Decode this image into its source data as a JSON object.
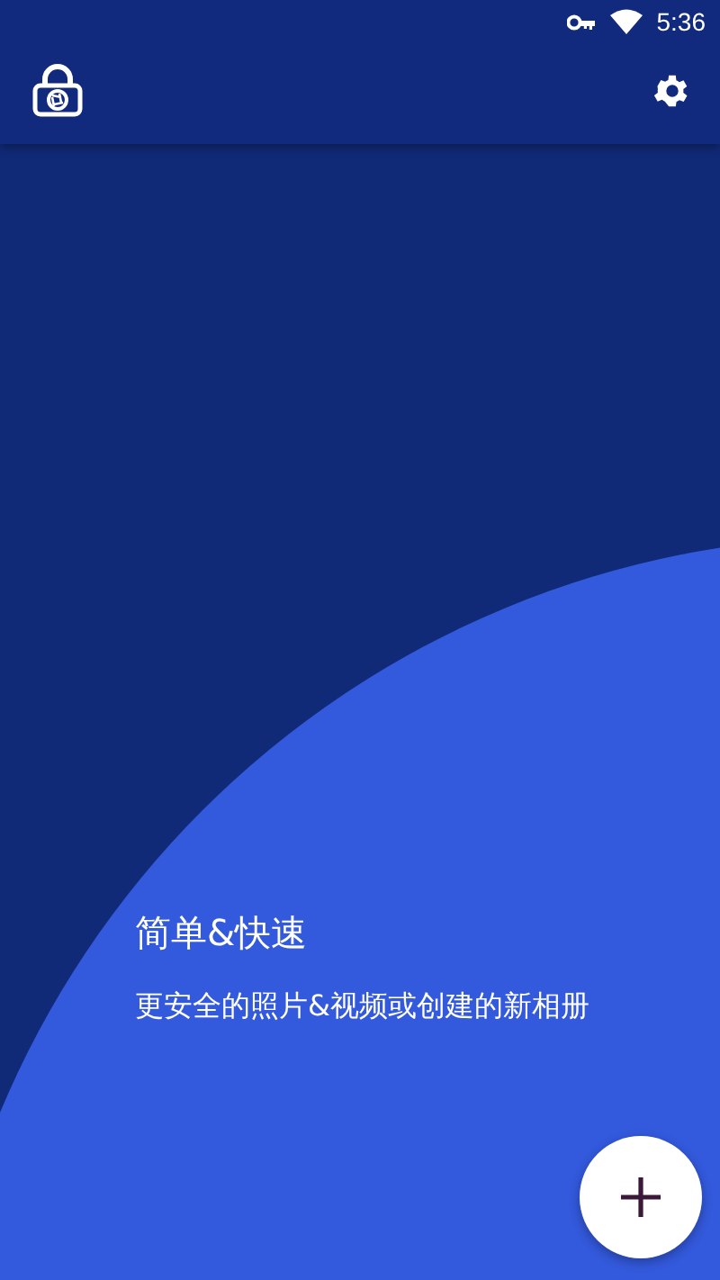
{
  "status_bar": {
    "time": "5:36"
  },
  "intro": {
    "title": "简单&快速",
    "subtitle": "更安全的照片&视频或创建的新相册"
  }
}
